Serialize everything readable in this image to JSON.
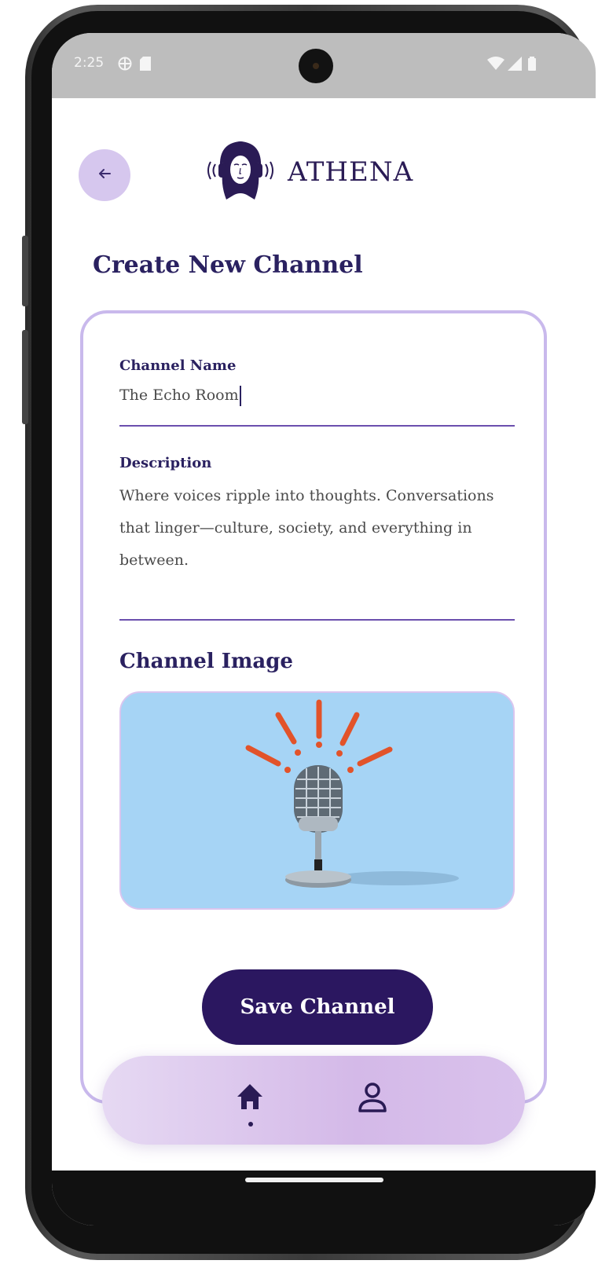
{
  "status_bar": {
    "time": "2:25",
    "icons": [
      "globe-icon",
      "sim-card-icon",
      "wifi-icon",
      "signal-icon",
      "battery-icon"
    ]
  },
  "header": {
    "back_icon": "arrow-left-icon",
    "brand_name": "ATHENA",
    "logo": "athena-headphones-logo"
  },
  "page": {
    "title": "Create New Channel"
  },
  "form": {
    "channel_name": {
      "label": "Channel Name",
      "value": "The Echo Room"
    },
    "description": {
      "label": "Description",
      "value": "Where voices ripple into thoughts. Conversations that linger—culture, society, and everything in between."
    },
    "channel_image": {
      "label": "Channel Image",
      "image": "vintage-microphone-on-blue-background"
    },
    "save_label": "Save Channel"
  },
  "bottom_nav": {
    "items": [
      {
        "icon": "home-icon",
        "active": true
      },
      {
        "icon": "profile-icon",
        "active": false
      }
    ]
  },
  "colors": {
    "primary": "#2b1760",
    "accent_light": "#d6c7ee",
    "card_border": "#c9b9ec",
    "input_underline": "#6b4fae",
    "image_bg": "#a6d4f5"
  }
}
